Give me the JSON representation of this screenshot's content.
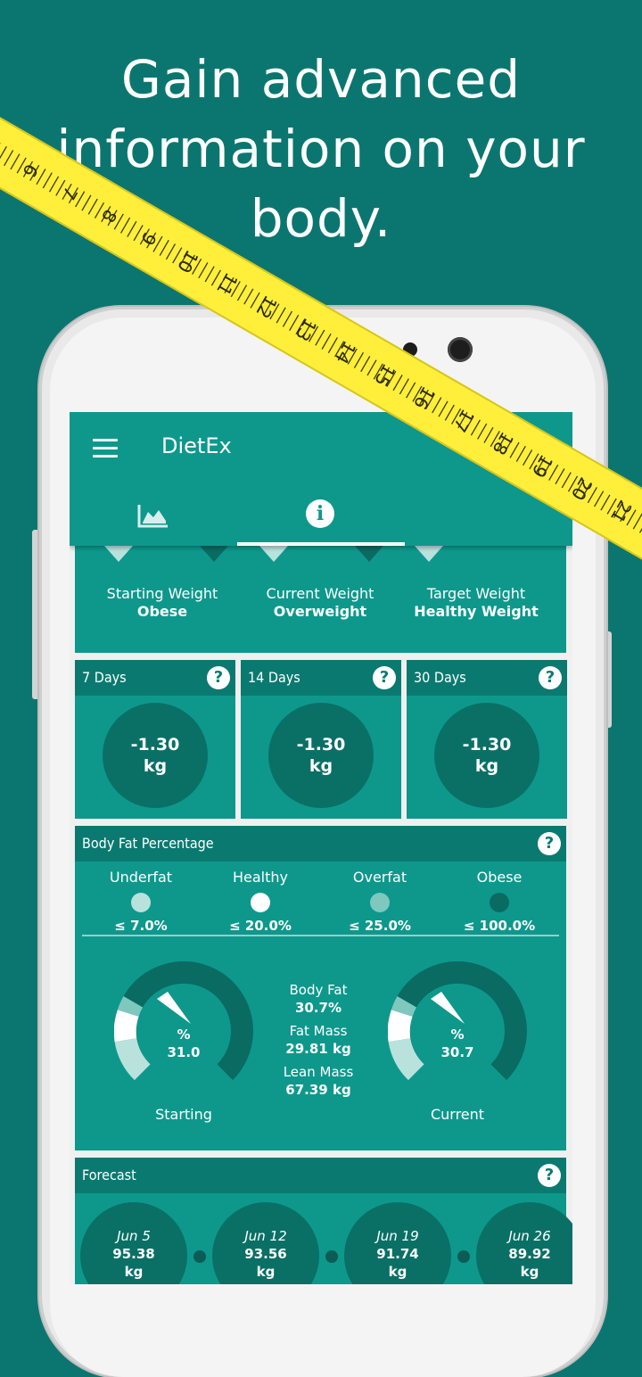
{
  "promo": {
    "line1": "Gain advanced",
    "line2": "information on your",
    "line3": "body."
  },
  "app": {
    "title": "DietEx",
    "tabs": [
      {
        "icon": "chart-icon"
      },
      {
        "icon": "info-icon",
        "glyph": "i"
      }
    ]
  },
  "weight_categories": [
    {
      "label": "Starting Weight",
      "value": "Obese"
    },
    {
      "label": "Current Weight",
      "value": "Overweight"
    },
    {
      "label": "Target Weight",
      "value": "Healthy Weight"
    }
  ],
  "days": [
    {
      "label": "7 Days",
      "value": "-1.30",
      "unit": "kg"
    },
    {
      "label": "14 Days",
      "value": "-1.30",
      "unit": "kg"
    },
    {
      "label": "30 Days",
      "value": "-1.30",
      "unit": "kg"
    }
  ],
  "help_glyph": "?",
  "body_fat": {
    "title": "Body Fat Percentage",
    "categories": [
      {
        "label": "Underfat",
        "threshold": "≤ 7.0%",
        "color": "#b9e2dd"
      },
      {
        "label": "Healthy",
        "threshold": "≤ 20.0%",
        "color": "#ffffff"
      },
      {
        "label": "Overfat",
        "threshold": "≤ 25.0%",
        "color": "#7ec8be"
      },
      {
        "label": "Obese",
        "threshold": "≤ 100.0%",
        "color": "#0a6b63"
      }
    ],
    "starting": {
      "label": "Starting",
      "unit": "%",
      "value": "31.0"
    },
    "current": {
      "label": "Current",
      "unit": "%",
      "value": "30.7"
    },
    "stats": [
      {
        "label": "Body Fat",
        "value": "30.7%"
      },
      {
        "label": "Fat Mass",
        "value": "29.81 kg"
      },
      {
        "label": "Lean Mass",
        "value": "67.39 kg"
      }
    ]
  },
  "forecast": {
    "title": "Forecast",
    "items": [
      {
        "date": "Jun 5",
        "value": "95.38",
        "unit": "kg"
      },
      {
        "date": "Jun 12",
        "value": "93.56",
        "unit": "kg"
      },
      {
        "date": "Jun 19",
        "value": "91.74",
        "unit": "kg"
      },
      {
        "date": "Jun 26",
        "value": "89.92",
        "unit": "kg"
      }
    ]
  },
  "tape_numbers": [
    "5",
    "6",
    "7",
    "8",
    "9",
    "10",
    "11",
    "12",
    "13",
    "14",
    "15",
    "16",
    "17",
    "18",
    "19",
    "20",
    "21"
  ],
  "colors": {
    "background": "#0b7670",
    "appbar": "#0e988c",
    "card_header": "#0a7a70",
    "tape": "#ffef3a"
  }
}
